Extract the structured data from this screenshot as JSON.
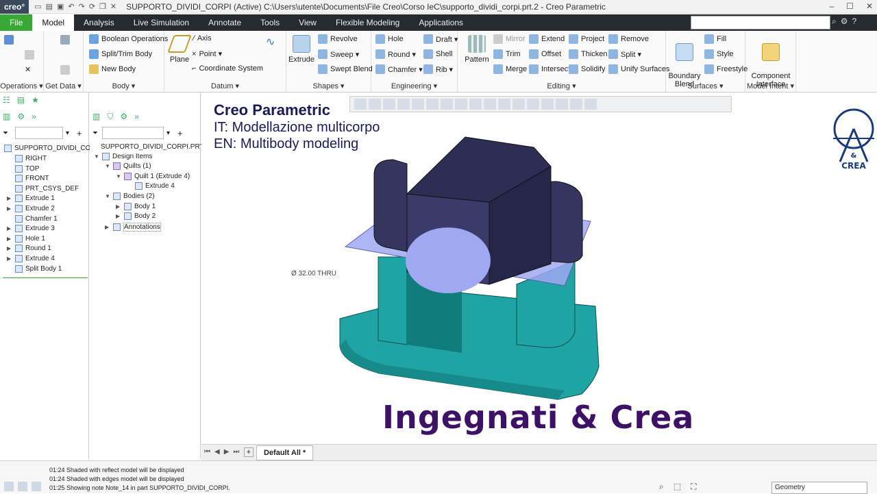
{
  "app": {
    "logo": "creo°",
    "window_title": "SUPPORTO_DIVIDI_CORPI (Active) C:\\Users\\utente\\Documents\\File Creo\\Corso IeC\\supporto_dividi_corpi.prt.2 - Creo Parametric"
  },
  "menu": {
    "tabs": [
      "File",
      "Model",
      "Analysis",
      "Live Simulation",
      "Annotate",
      "Tools",
      "View",
      "Flexible Modeling",
      "Applications"
    ],
    "active": "Model"
  },
  "ribbon": {
    "groups": {
      "operations": "Operations ▾",
      "get_data": "Get Data ▾",
      "body": "Body ▾",
      "datum": "Datum ▾",
      "shapes": "Shapes ▾",
      "engineering": "Engineering ▾",
      "editing": "Editing ▾",
      "surfaces": "Surfaces ▾",
      "model_intent": "Model Intent ▾"
    },
    "body": {
      "boolean": "Boolean Operations",
      "split_trim": "Split/Trim Body",
      "new_body": "New Body"
    },
    "datum": {
      "plane": "Plane",
      "axis": "Axis",
      "point": "Point ▾",
      "csys": "Coordinate System"
    },
    "shapes": {
      "extrude": "Extrude",
      "revolve": "Revolve",
      "sweep": "Sweep ▾",
      "swept_blend": "Swept Blend"
    },
    "engineering": {
      "hole": "Hole",
      "round": "Round ▾",
      "chamfer": "Chamfer ▾",
      "draft": "Draft ▾",
      "shell": "Shell",
      "rib": "Rib ▾"
    },
    "editing": {
      "pattern": "Pattern",
      "mirror": "Mirror",
      "trim": "Trim",
      "merge": "Merge",
      "extend": "Extend",
      "offset": "Offset",
      "intersect": "Intersect",
      "project": "Project",
      "thicken": "Thicken",
      "solidify": "Solidify",
      "remove": "Remove",
      "split": "Split ▾",
      "unify": "Unify Surfaces"
    },
    "surfaces": {
      "boundary_blend": "Boundary\nBlend",
      "fill": "Fill",
      "style": "Style",
      "freestyle": "Freestyle"
    },
    "model_intent": {
      "component_interface": "Component\nInterface"
    }
  },
  "model_tree": {
    "root": "SUPPORTO_DIVIDI_CORPI.PRT",
    "items": [
      "RIGHT",
      "TOP",
      "FRONT",
      "PRT_CSYS_DEF",
      "Extrude 1",
      "Extrude 2",
      "Chamfer 1",
      "Extrude 3",
      "Hole 1",
      "Round 1",
      "Extrude 4",
      "Split Body 1"
    ]
  },
  "design_tree": {
    "root": "SUPPORTO_DIVIDI_CORPI.PRT",
    "design_items": "Design Items",
    "quilts": "Quilts (1)",
    "quilt1": "Quilt 1 (Extrude 4)",
    "extrude4": "Extrude 4",
    "bodies": "Bodies (2)",
    "body1": "Body 1",
    "body2": "Body 2",
    "annotations": "Annotations"
  },
  "viewport": {
    "heading_title": "Creo Parametric",
    "heading_it": "IT: Modellazione multicorpo",
    "heading_en": "EN: Multibody modeling",
    "brand": "Ingegnati & Crea",
    "hole_note": "Ø 32.00  THRU",
    "logo_text": "INGEGNATI & CREA"
  },
  "view_tab": "Default All *",
  "status": {
    "messages": [
      "01:24  Shaded with reflect model will be displayed",
      "01:24  Shaded with edges model will be displayed",
      "01:25  Showing note Note_14 in part SUPPORTO_DIVIDI_CORPI."
    ],
    "filter": "Geometry"
  },
  "colors": {
    "body_top": "#35355f",
    "body_bottom": "#1fa3a3",
    "quilt": "#9fa8f0",
    "brand": "#3d1166",
    "menubar": "#262b31",
    "file_tab": "#39a935"
  }
}
